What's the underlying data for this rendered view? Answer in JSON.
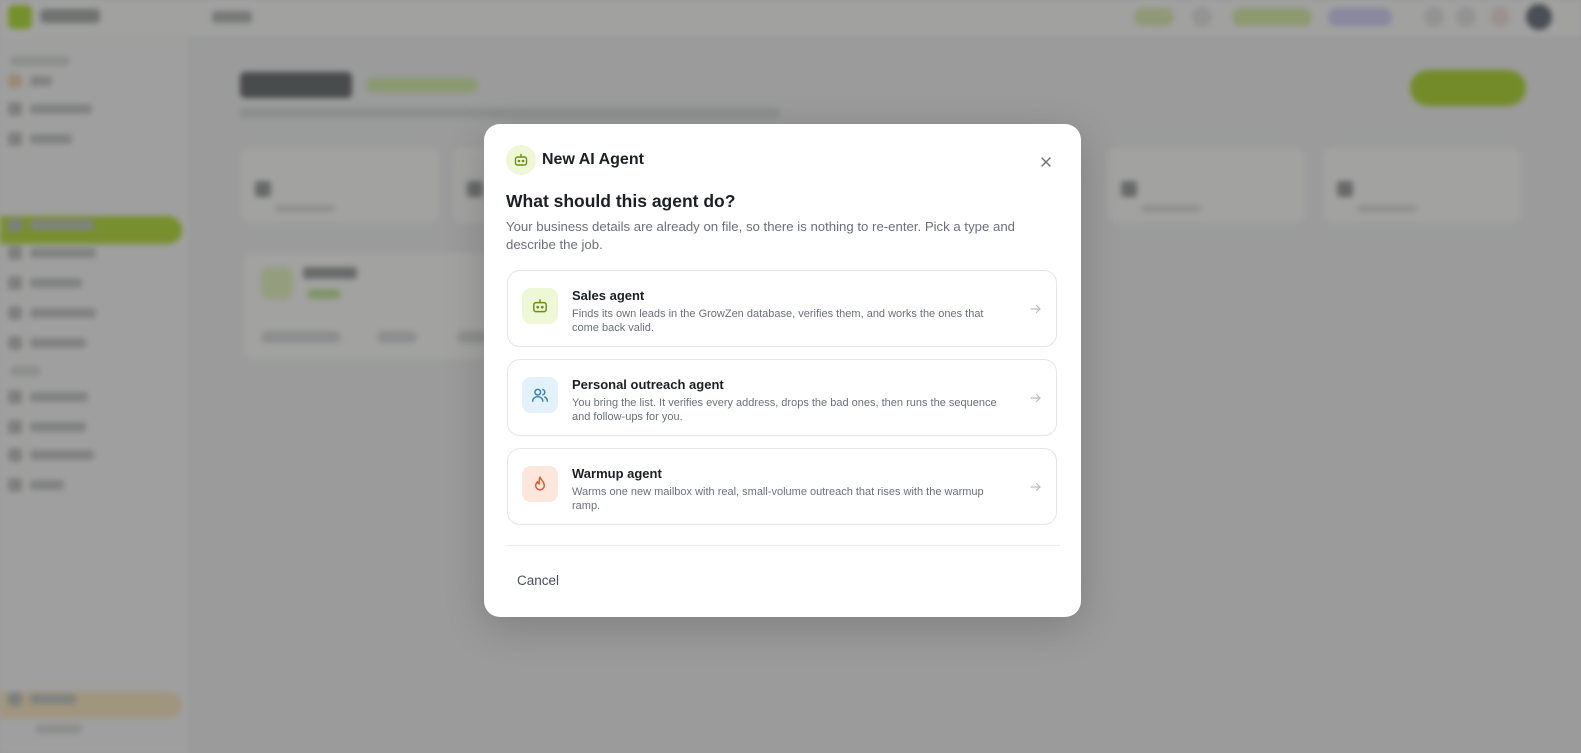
{
  "modal": {
    "title": "New AI Agent",
    "question": "What should this agent do?",
    "description": "Your business details are already on file, so there is nothing to re-enter. Pick a type and describe the job.",
    "options": [
      {
        "title": "Sales agent",
        "description": "Finds its own leads in the GrowZen database, verifies them, and works the ones that come back valid.",
        "icon": "robot-icon",
        "icon_bg": "#eef7d6",
        "icon_color": "#6a8f14"
      },
      {
        "title": "Personal outreach agent",
        "description": "You bring the list. It verifies every address, drops the bad ones, then runs the sequence and follow-ups for you.",
        "icon": "users-icon",
        "icon_bg": "#e3f1fb",
        "icon_color": "#3b82b8"
      },
      {
        "title": "Warmup agent",
        "description": "Warms one new mailbox with real, small-volume outreach that rises with the warmup ramp.",
        "icon": "flame-icon",
        "icon_bg": "#fde6dc",
        "icon_color": "#e0582a"
      }
    ],
    "cancel_label": "Cancel"
  },
  "colors": {
    "accent": "#a6d41f",
    "overlay": "rgba(60,60,60,0.45)"
  }
}
